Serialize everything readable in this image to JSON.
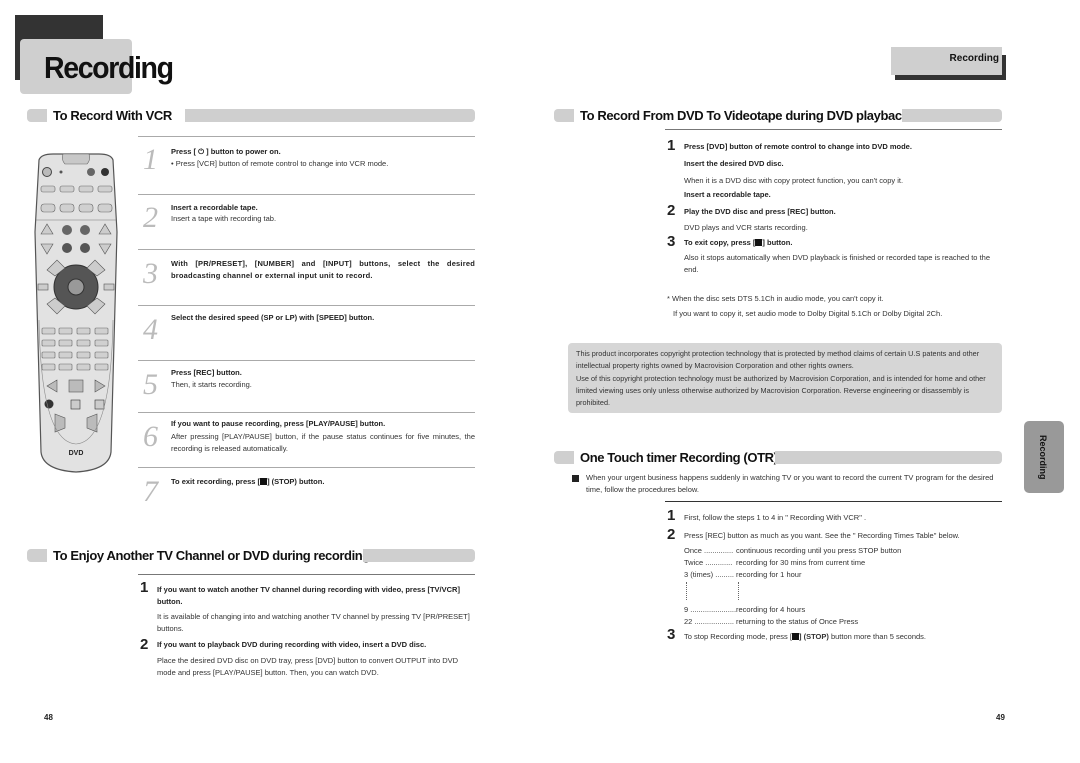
{
  "header": {
    "left_title": "Recording",
    "right_tab": "Recording",
    "side_tab": "Recording"
  },
  "vcr": {
    "title": "To Record With VCR",
    "steps": [
      {
        "num": "1",
        "bold": "Press [ ⏻ ] button to power on.",
        "text": "• Press [VCR] button of remote control to change into VCR mode."
      },
      {
        "num": "2",
        "bold": "Insert a recordable tape.",
        "text": "Insert a tape with recording tab."
      },
      {
        "num": "3",
        "bold": "With [PR/PRESET], [NUMBER] and [INPUT] buttons, select the desired broadcasting channel or external input unit to record.",
        "text": ""
      },
      {
        "num": "4",
        "bold": "Select the desired speed (SP or LP) with [SPEED] button.",
        "text": ""
      },
      {
        "num": "5",
        "bold": "Press [REC] button.",
        "text": "Then, it starts recording."
      },
      {
        "num": "6",
        "bold": "If you want to pause recording, press [PLAY/PAUSE] button.",
        "text": "After pressing [PLAY/PAUSE] button, if the pause status continues for five minutes, the recording is released automatically."
      },
      {
        "num": "7",
        "bold_pre": "To exit recording, press [",
        "bold_post": "] (STOP) button.",
        "text": ""
      }
    ]
  },
  "enjoy": {
    "title": "To Enjoy Another TV Channel or DVD during recording",
    "steps": [
      {
        "num": "1",
        "bold": "If you want to watch another TV channel during recording with video, press [TV/VCR] button.",
        "text": "It is available of changing into and watching another TV channel by pressing TV [PR/PRESET] buttons."
      },
      {
        "num": "2",
        "bold": "If you want to playback DVD during recording with video, insert a DVD disc.",
        "text": "Place the desired DVD disc on DVD tray, press [DVD] button to convert OUTPUT into DVD mode and press [PLAY/PAUSE] button. Then, you can watch DVD."
      }
    ]
  },
  "dvd": {
    "title": "To Record From DVD To Videotape during DVD playback",
    "step1_num": "1",
    "step1_bold": "Press [DVD] button of remote control to change into DVD mode.",
    "step1_bold2": "Insert the desired DVD disc.",
    "step1_text": "When it is a DVD disc with copy protect function, you can't copy it.",
    "step1_bold3": "Insert a recordable tape.",
    "step2_num": "2",
    "step2_bold": "Play the DVD disc and press [REC] button.",
    "step2_text": "DVD plays and VCR starts recording.",
    "step3_num": "3",
    "step3_bold_pre": "To exit copy, press [",
    "step3_bold_post": "] button.",
    "step3_text": "Also it stops automatically when DVD playback is finished or recorded tape is reached to the end.",
    "note1": "* When the disc sets DTS 5.1Ch in audio mode, you can't copy it.",
    "note2": "If you want to copy it, set audio mode to Dolby Digital 5.1Ch or Dolby Digital 2Ch."
  },
  "notice": {
    "p1": "This product incorporates copyright protection technology that is protected by method claims of certain U.S patents and other intellectual property rights owned by Macrovision Corporation and other rights owners.",
    "p2": "Use of this copyright protection technology must be authorized by Macrovision Corporation, and is intended for home and other limited viewing uses only unless otherwise authorized by Macrovision Corporation. Reverse engineering or disassembly is prohibited."
  },
  "otr": {
    "title": "One Touch timer Recording (OTR)",
    "intro": "When your urgent business happens suddenly in watching TV or you want to record the current TV program for the desired time, follow the procedures below.",
    "step1_num": "1",
    "step1": "First, follow the steps 1 to 4 in \" Recording With VCR\" .",
    "step2_num": "2",
    "step2": "Press [REC] button as much as you want. See the \" Recording Times Table\"  below.",
    "table": [
      {
        "press": "Once ..............",
        "result": "continuous recording until you press STOP button"
      },
      {
        "press": "Twice .............",
        "result": "recording for 30 mins from current time"
      },
      {
        "press": "3 (times) .........",
        "result": "recording for 1 hour"
      },
      {
        "press": "9 ......................",
        "result": "recording for 4 hours"
      },
      {
        "press": "22 ...................",
        "result": "returning to the status of Once Press"
      }
    ],
    "step3_num": "3",
    "step3_pre": "To  stop Recording mode, press  [",
    "step3_stop": "] (STOP)",
    "step3_post": " button more than 5 seconds."
  },
  "pages": {
    "left": "48",
    "right": "49"
  },
  "remote": {
    "logo": "DVD"
  }
}
